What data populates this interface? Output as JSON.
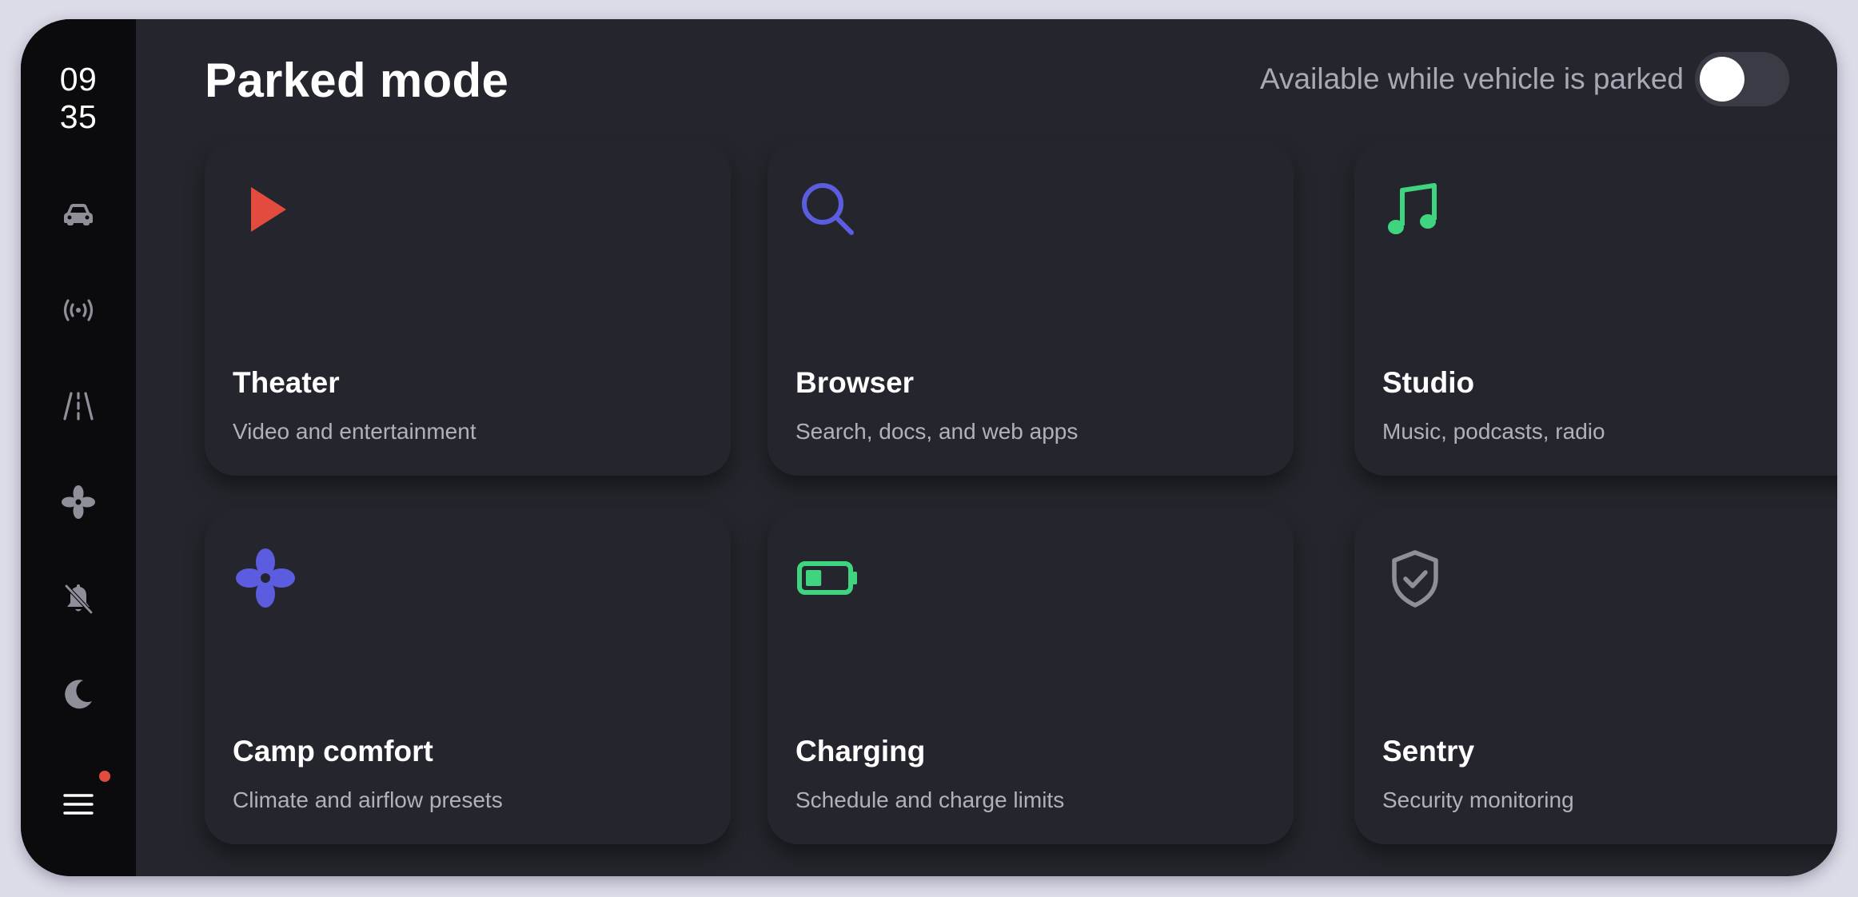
{
  "clock": {
    "hour": "09",
    "minute": "35"
  },
  "rail": {
    "items": [
      {
        "icon": "car-icon"
      },
      {
        "icon": "wireless-signal-icon"
      },
      {
        "icon": "road-icon"
      },
      {
        "icon": "fan-icon"
      },
      {
        "icon": "bell-muted-icon"
      },
      {
        "icon": "moon-icon"
      },
      {
        "icon": "menu-icon",
        "notification_dot": true
      }
    ]
  },
  "header": {
    "title": "Parked mode",
    "parked_label": "Available while vehicle is parked",
    "parked_toggle_on": false
  },
  "cards": [
    {
      "title": "Theater",
      "subtitle": "Video and entertainment",
      "icon": "play-icon",
      "icon_color": "#e24b3e"
    },
    {
      "title": "Browser",
      "subtitle": "Search, docs, and web apps",
      "icon": "search-icon",
      "icon_color": "#5b5ce0"
    },
    {
      "title": "Studio",
      "subtitle": "Music, podcasts, radio",
      "icon": "music-note-icon",
      "icon_color": "#3fd47f"
    },
    {
      "title": "Camp comfort",
      "subtitle": "Climate and airflow presets",
      "icon": "fan-icon",
      "icon_color": "#5b5ce0"
    },
    {
      "title": "Charging",
      "subtitle": "Schedule and charge limits",
      "icon": "battery-icon",
      "icon_color": "#3fd47f",
      "battery_level": 0.4
    },
    {
      "title": "Sentry",
      "subtitle": "Security monitoring",
      "icon": "shield-check-icon",
      "icon_color": "#8e8f99"
    }
  ],
  "colors": {
    "background": "#25262d",
    "rail": "#0b0b0d",
    "accent_red": "#e24b3e",
    "accent_blue": "#5b5ce0",
    "accent_green": "#3fd47f"
  }
}
